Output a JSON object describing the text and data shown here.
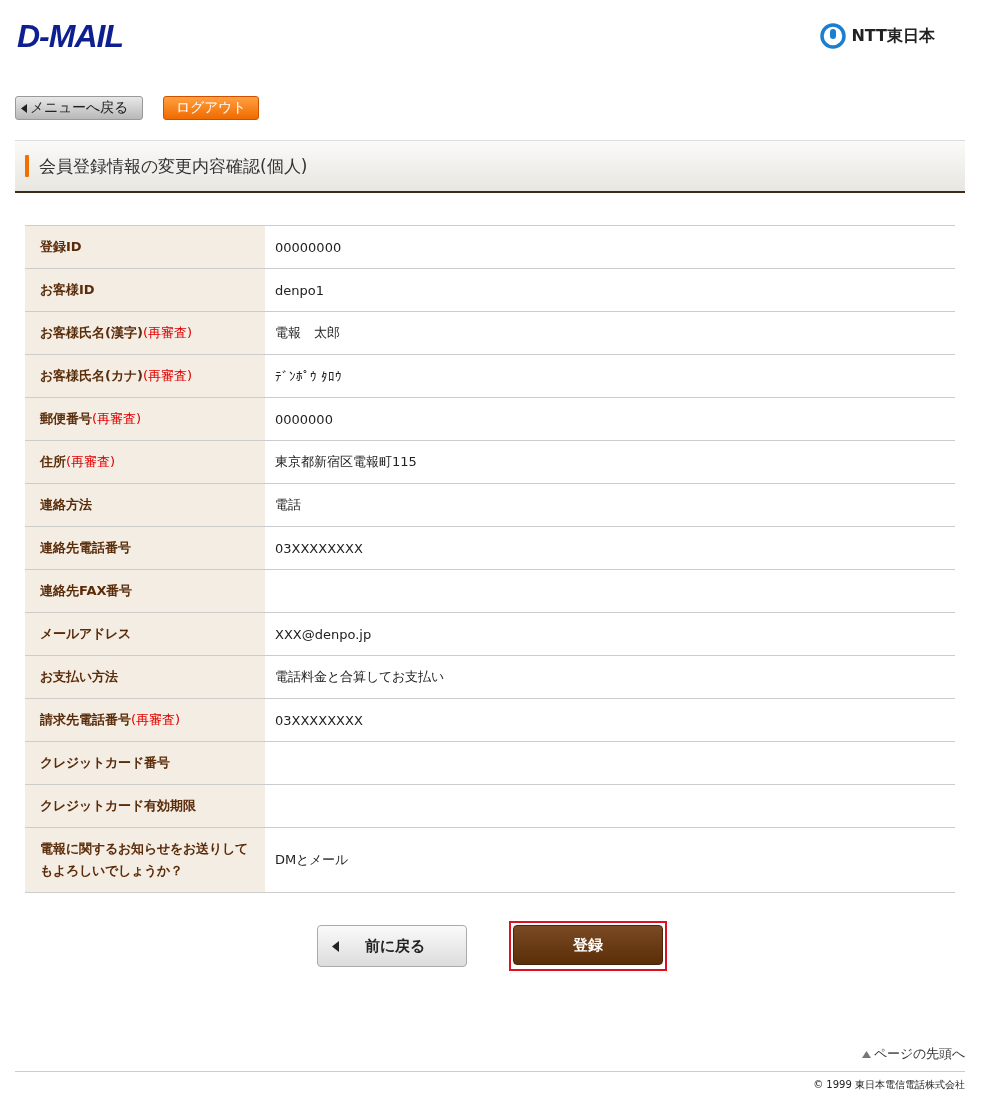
{
  "header": {
    "logo": "D-MAIL",
    "company": "NTT東日本"
  },
  "nav": {
    "back_button": "メニューへ戻る",
    "logout_button": "ログアウト"
  },
  "page_title": "会員登録情報の変更内容確認(個人)",
  "table": {
    "rows": [
      {
        "label": "登録ID",
        "value": "00000000"
      },
      {
        "label": "お客様ID",
        "value": "denpo1"
      },
      {
        "label": "お客様氏名(漢字)",
        "note": "(再審査)",
        "value": "電報　太郎"
      },
      {
        "label": "お客様氏名(カナ)",
        "note": "(再審査)",
        "value": "ﾃﾞﾝﾎﾟｳ ﾀﾛｳ"
      },
      {
        "label": "郵便番号",
        "note": "(再審査)",
        "value": "0000000"
      },
      {
        "label": "住所",
        "note": "(再審査)",
        "value": "東京都新宿区電報町115"
      },
      {
        "label": "連絡方法",
        "value": "電話"
      },
      {
        "label": "連絡先電話番号",
        "value": "03XXXXXXXX"
      },
      {
        "label": "連絡先FAX番号"
      },
      {
        "label": "メールアドレス",
        "value": "XXX@denpo.jp"
      },
      {
        "label": "お支払い方法",
        "value": "電話料金と合算してお支払い"
      },
      {
        "label": "請求先電話番号",
        "note": "(再審査)",
        "value": "03XXXXXXXX"
      },
      {
        "label": "クレジットカード番号"
      },
      {
        "label": "クレジットカード有効期限"
      },
      {
        "label": "電報に関するお知らせをお送りしてもよろしいでしょうか？",
        "value": "DMとメール"
      }
    ]
  },
  "actions": [
    {
      "kind": "back",
      "label": "前に戻る",
      "highlighted": false
    },
    {
      "kind": "submit",
      "label": "登録",
      "highlighted": true
    }
  ],
  "footer": {
    "page_top_link": "ページの先頭へ",
    "copyright": "© 1999 東日本電信電話株式会社"
  }
}
